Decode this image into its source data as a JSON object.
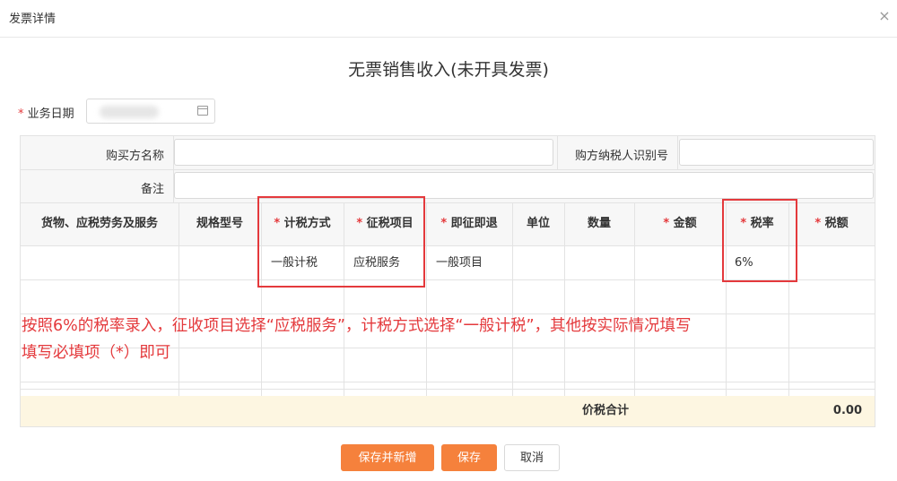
{
  "dialog": {
    "title": "发票详情",
    "close": "×"
  },
  "main_title": "无票销售收入(未开具发票)",
  "business_date": {
    "required_mark": "*",
    "label": "业务日期",
    "icon": "calendar-icon"
  },
  "buyer": {
    "name_label": "购买方名称",
    "name_value": "",
    "taxid_label": "购方纳税人识别号",
    "taxid_value": "",
    "remark_label": "备注",
    "remark_value": ""
  },
  "columns": [
    {
      "label": "货物、应税劳务及服务",
      "required": false
    },
    {
      "label": "规格型号",
      "required": false
    },
    {
      "label": "计税方式",
      "required": true
    },
    {
      "label": "征税项目",
      "required": true
    },
    {
      "label": "即征即退",
      "required": true
    },
    {
      "label": "单位",
      "required": false
    },
    {
      "label": "数量",
      "required": false
    },
    {
      "label": "金额",
      "required": true
    },
    {
      "label": "税率",
      "required": true
    },
    {
      "label": "税额",
      "required": true
    }
  ],
  "row1": {
    "tax_method": "一般计税",
    "tax_item": "应税服务",
    "refund": "一般项目",
    "rate": "6%"
  },
  "annotation": {
    "line1": "按照6%的税率录入，征收项目选择“应税服务”，计税方式选择“一般计税”，其他按实际情况填写",
    "line2": "填写必填项（*）即可",
    "color": "#e4393c"
  },
  "total": {
    "label": "价税合计",
    "value": "0.00"
  },
  "buttons": {
    "save_new": "保存并新增",
    "save": "保存",
    "cancel": "取消"
  },
  "colors": {
    "accent": "#f5813c",
    "required": "#e4393c",
    "total_bg": "#fdf6e1",
    "header_bg": "#f7f7f7"
  }
}
